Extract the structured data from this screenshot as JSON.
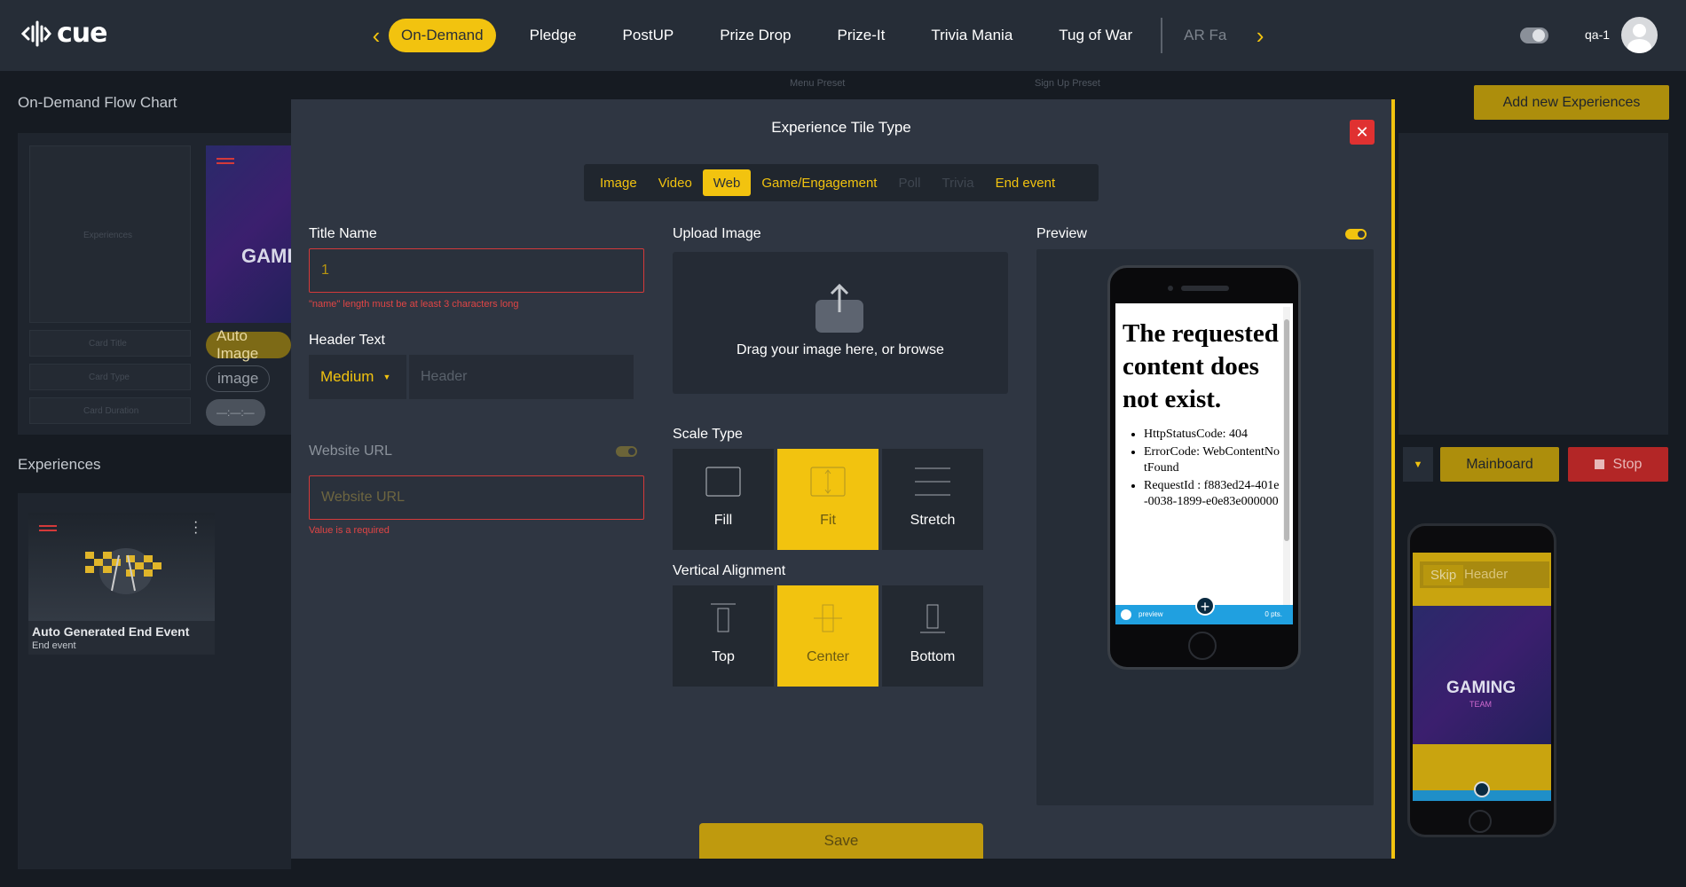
{
  "app": {
    "logo_text": "cue",
    "user": "qa-1"
  },
  "nav": {
    "tabs": [
      {
        "label": "On-Demand",
        "active": true
      },
      {
        "label": "Pledge"
      },
      {
        "label": "PostUP"
      },
      {
        "label": "Prize Drop"
      },
      {
        "label": "Prize-It"
      },
      {
        "label": "Trivia Mania"
      },
      {
        "label": "Tug of War"
      },
      {
        "label": "AR Fa"
      }
    ]
  },
  "background": {
    "flow_title": "On-Demand Flow Chart",
    "experiences_title": "Experiences",
    "menu_preset_label": "Menu Preset",
    "signup_preset_label": "Sign Up Preset",
    "add_button": "Add new Experiences",
    "mainboard_button": "Mainboard",
    "stop_button": "Stop",
    "ghost_experiences": "Experiences",
    "ghost_card_title": "Card Title",
    "ghost_card_type": "Card Type",
    "ghost_card_duration": "Card Duration",
    "chip_auto_image": "Auto Image",
    "chip_image": "image",
    "chip_dash": "—:—:—",
    "exp_card": {
      "title": "Auto Generated End Event",
      "subtitle": "End event"
    },
    "phone_skip": "Skip",
    "phone_header": "Header",
    "game_title": "GAMING",
    "game_sub": "TEAM"
  },
  "modal": {
    "title": "Experience Tile Type",
    "tabs": [
      {
        "label": "Image",
        "state": "normal"
      },
      {
        "label": "Video",
        "state": "normal"
      },
      {
        "label": "Web",
        "state": "active"
      },
      {
        "label": "Game/Engagement",
        "state": "normal"
      },
      {
        "label": "Poll",
        "state": "disabled"
      },
      {
        "label": "Trivia",
        "state": "disabled"
      },
      {
        "label": "End event",
        "state": "normal"
      }
    ],
    "title_name_label": "Title Name",
    "title_name_value": "1",
    "title_name_error": "\"name\" length must be at least 3 characters long",
    "header_text_label": "Header Text",
    "header_size": "Medium",
    "header_placeholder": "Header",
    "website_url_label": "Website URL",
    "website_url_placeholder": "Website URL",
    "website_url_error": "Value is a required",
    "upload_label": "Upload Image",
    "upload_text": "Drag your image here, or browse",
    "scale_label": "Scale Type",
    "scale_options": [
      {
        "label": "Fill",
        "icon": "fill-icon",
        "active": false
      },
      {
        "label": "Fit",
        "icon": "fit-icon",
        "active": true
      },
      {
        "label": "Stretch",
        "icon": "stretch-icon",
        "active": false
      }
    ],
    "valign_label": "Vertical Alignment",
    "valign_options": [
      {
        "label": "Top",
        "icon": "align-top-icon",
        "active": false
      },
      {
        "label": "Center",
        "icon": "align-center-icon",
        "active": true
      },
      {
        "label": "Bottom",
        "icon": "align-bottom-icon",
        "active": false
      }
    ],
    "preview_label": "Preview",
    "preview_enabled": true,
    "preview_page": {
      "heading": "The requested content does not exist.",
      "items": [
        "HttpStatusCode: 404",
        "ErrorCode: WebContentNotFound",
        "RequestId : f883ed24-401e-0038-1899-e0e83e000000"
      ],
      "bar_text": "preview",
      "bar_pts": "0 pts."
    },
    "save_button": "Save"
  },
  "colors": {
    "accent": "#f2c30f",
    "error": "#e03131",
    "background": "#161b22",
    "modal": "#2f3642"
  }
}
